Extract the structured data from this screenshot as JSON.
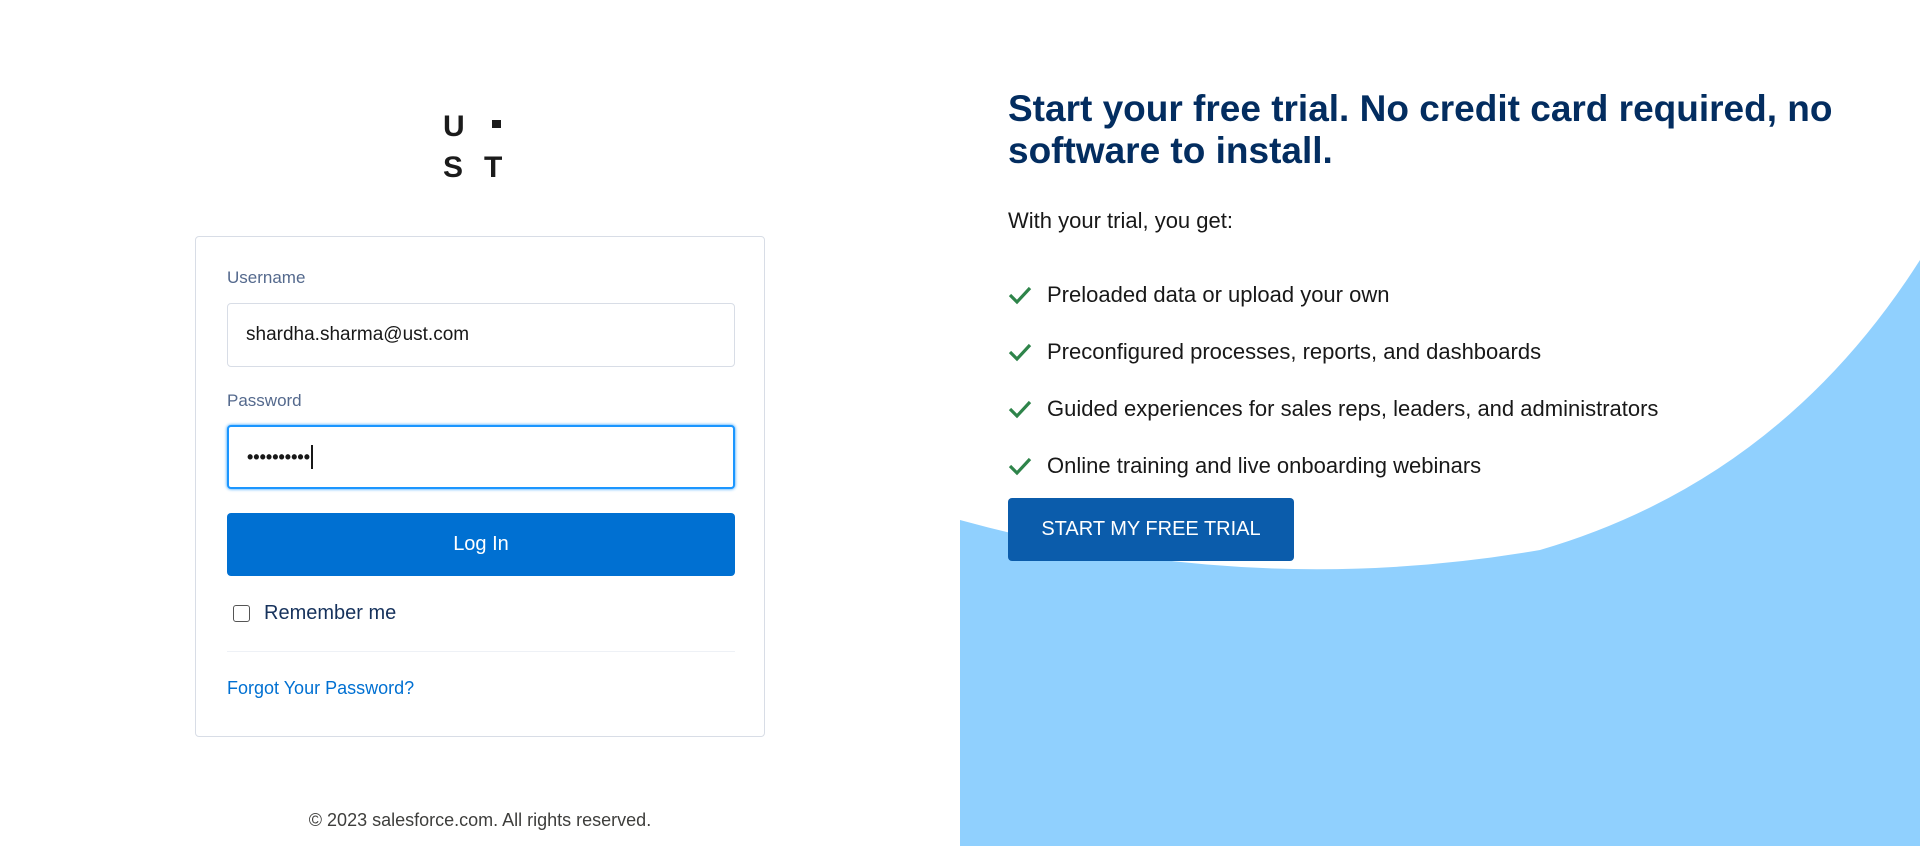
{
  "logo": {
    "top_letters": [
      "U",
      "·"
    ],
    "bottom_letters": [
      "S",
      "T"
    ],
    "icon": "ust-logo"
  },
  "login": {
    "username_label": "Username",
    "username_value": "shardha.sharma@ust.com",
    "password_label": "Password",
    "password_dots": "••••••••••",
    "login_button": "Log In",
    "remember_label": "Remember me",
    "remember_checked": false,
    "forgot_link": "Forgot Your Password?"
  },
  "footer": {
    "copyright": "© 2023 salesforce.com. All rights reserved."
  },
  "promo": {
    "headline": "Start your free trial. No credit card required, no software to install.",
    "subhead": "With your trial, you get:",
    "features": [
      {
        "text": "Preloaded data or upload your own",
        "icon": "check-icon"
      },
      {
        "text": "Preconfigured processes, reports, and dashboards",
        "icon": "check-icon"
      },
      {
        "text": "Guided experiences for sales reps, leaders, and administrators",
        "icon": "check-icon"
      },
      {
        "text": "Online training and live onboarding webinars",
        "icon": "check-icon"
      }
    ],
    "cta_button": "START MY FREE TRIAL"
  },
  "colors": {
    "primary_button": "#0070d2",
    "cta_button": "#0b5cab",
    "headline": "#032d60",
    "check": "#2e844a",
    "background_shape": "#90d0fe",
    "focus_border": "#1b96ff"
  }
}
